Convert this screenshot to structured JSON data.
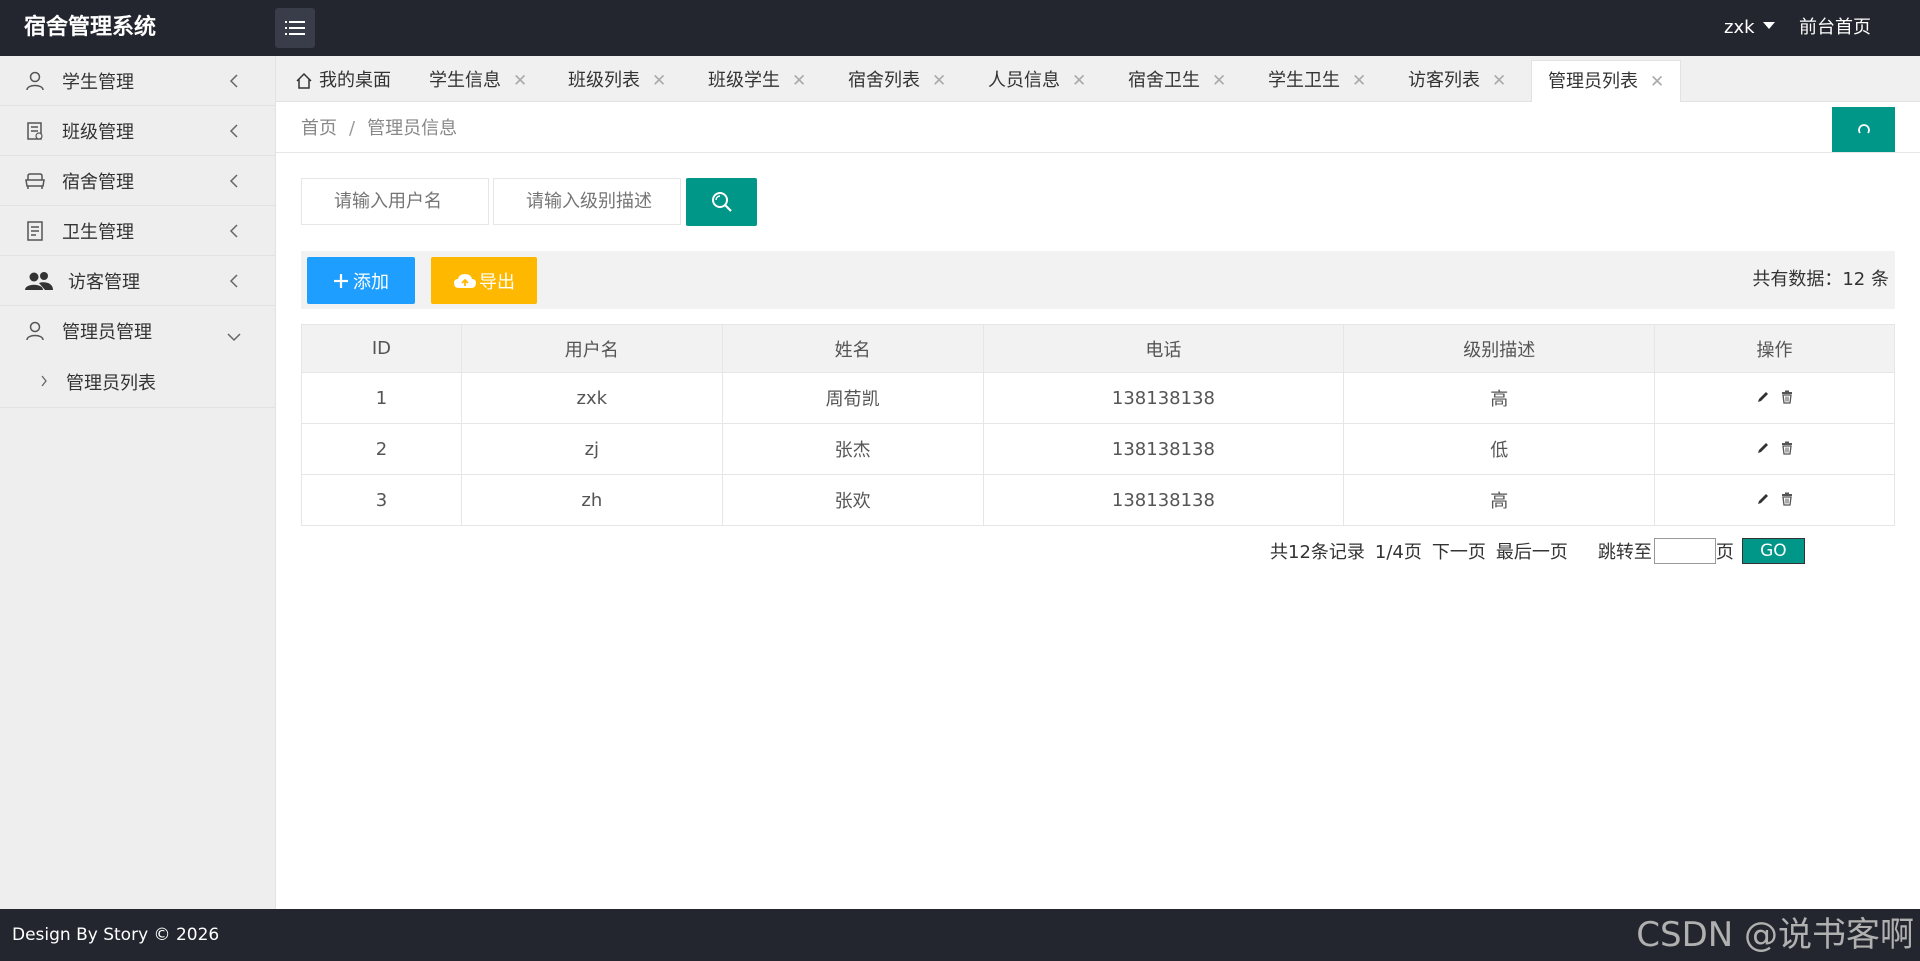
{
  "header": {
    "title": "宿舍管理系统",
    "user": "zxk",
    "front_link": "前台首页"
  },
  "sidebar": {
    "items": [
      {
        "label": "学生管理",
        "icon": "user-icon"
      },
      {
        "label": "班级管理",
        "icon": "class-icon"
      },
      {
        "label": "宿舍管理",
        "icon": "sofa-icon"
      },
      {
        "label": "卫生管理",
        "icon": "document-icon"
      },
      {
        "label": "访客管理",
        "icon": "users-icon"
      },
      {
        "label": "管理员管理",
        "icon": "user-icon"
      }
    ],
    "subitem": "管理员列表"
  },
  "tabs": {
    "home": "我的桌面",
    "items": [
      "学生信息",
      "班级列表",
      "班级学生",
      "宿舍列表",
      "人员信息",
      "宿舍卫生",
      "学生卫生",
      "访客列表",
      "管理员列表"
    ]
  },
  "breadcrumb": {
    "home": "首页",
    "sep": "/",
    "current": "管理员信息"
  },
  "search": {
    "username_placeholder": "请输入用户名",
    "level_placeholder": "请输入级别描述"
  },
  "toolbar": {
    "add_label": "添加",
    "export_label": "导出",
    "total_prefix": "共有数据：",
    "total_count": "12",
    "total_suffix": " 条"
  },
  "table": {
    "headers": [
      "ID",
      "用户名",
      "姓名",
      "电话",
      "级别描述",
      "操作"
    ],
    "rows": [
      {
        "id": "1",
        "username": "zxk",
        "name": "周荀凯",
        "phone": "138138138",
        "level": "高"
      },
      {
        "id": "2",
        "username": "zj",
        "name": "张杰",
        "phone": "138138138",
        "level": "低"
      },
      {
        "id": "3",
        "username": "zh",
        "name": "张欢",
        "phone": "138138138",
        "level": "高"
      }
    ]
  },
  "pager": {
    "records": "共12条记录",
    "page": "1/4页",
    "next": "下一页",
    "last": "最后一页",
    "jump_label": "跳转至",
    "page_unit": "页",
    "go": "GO"
  },
  "footer": {
    "text": "Design By Story © 2026",
    "watermark": "CSDN @说书客啊"
  },
  "colors": {
    "header_bg": "#23262e",
    "primary": "#009688",
    "add": "#1e9fff",
    "export": "#ffb800"
  }
}
